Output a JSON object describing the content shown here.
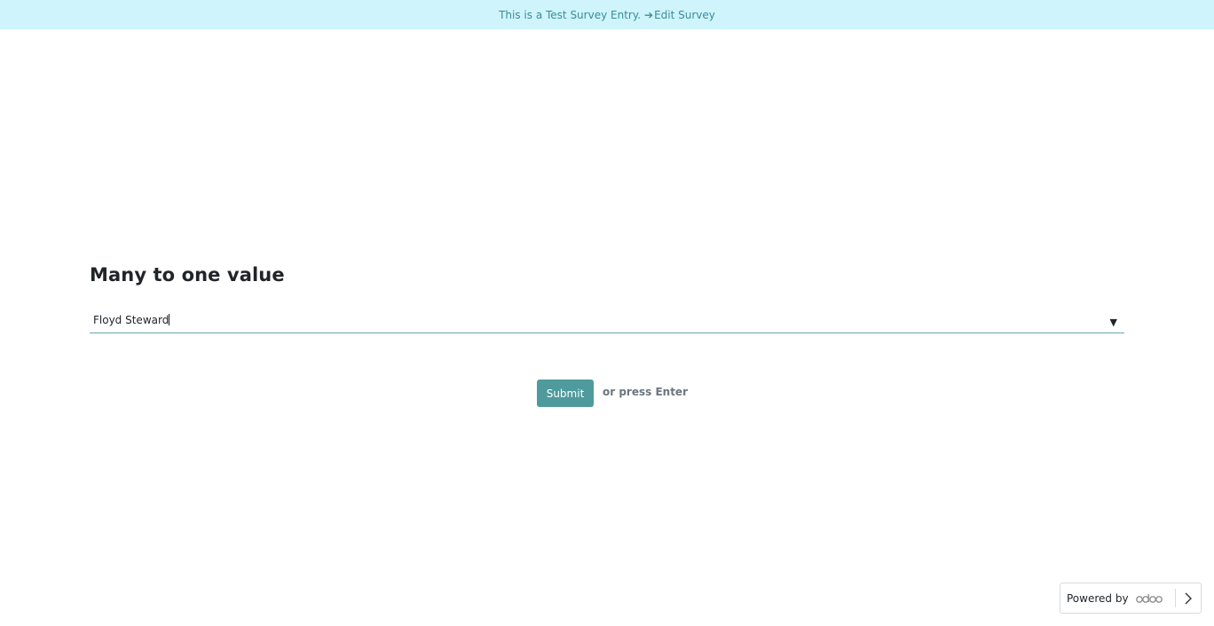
{
  "banner": {
    "text": "This is a Test Survey Entry.",
    "arrow": "➔",
    "link": "Edit Survey"
  },
  "question": {
    "title": "Many to one value",
    "selected_value": "Floyd Steward",
    "arrow_glyph": "▼"
  },
  "actions": {
    "submit_label": "Submit",
    "hint": "or press Enter"
  },
  "footer": {
    "powered_by": "Powered by",
    "brand": "odoo"
  },
  "colors": {
    "banner_bg": "#cff4fc",
    "banner_text": "#3a8d96",
    "accent": "#4e9a9c"
  }
}
